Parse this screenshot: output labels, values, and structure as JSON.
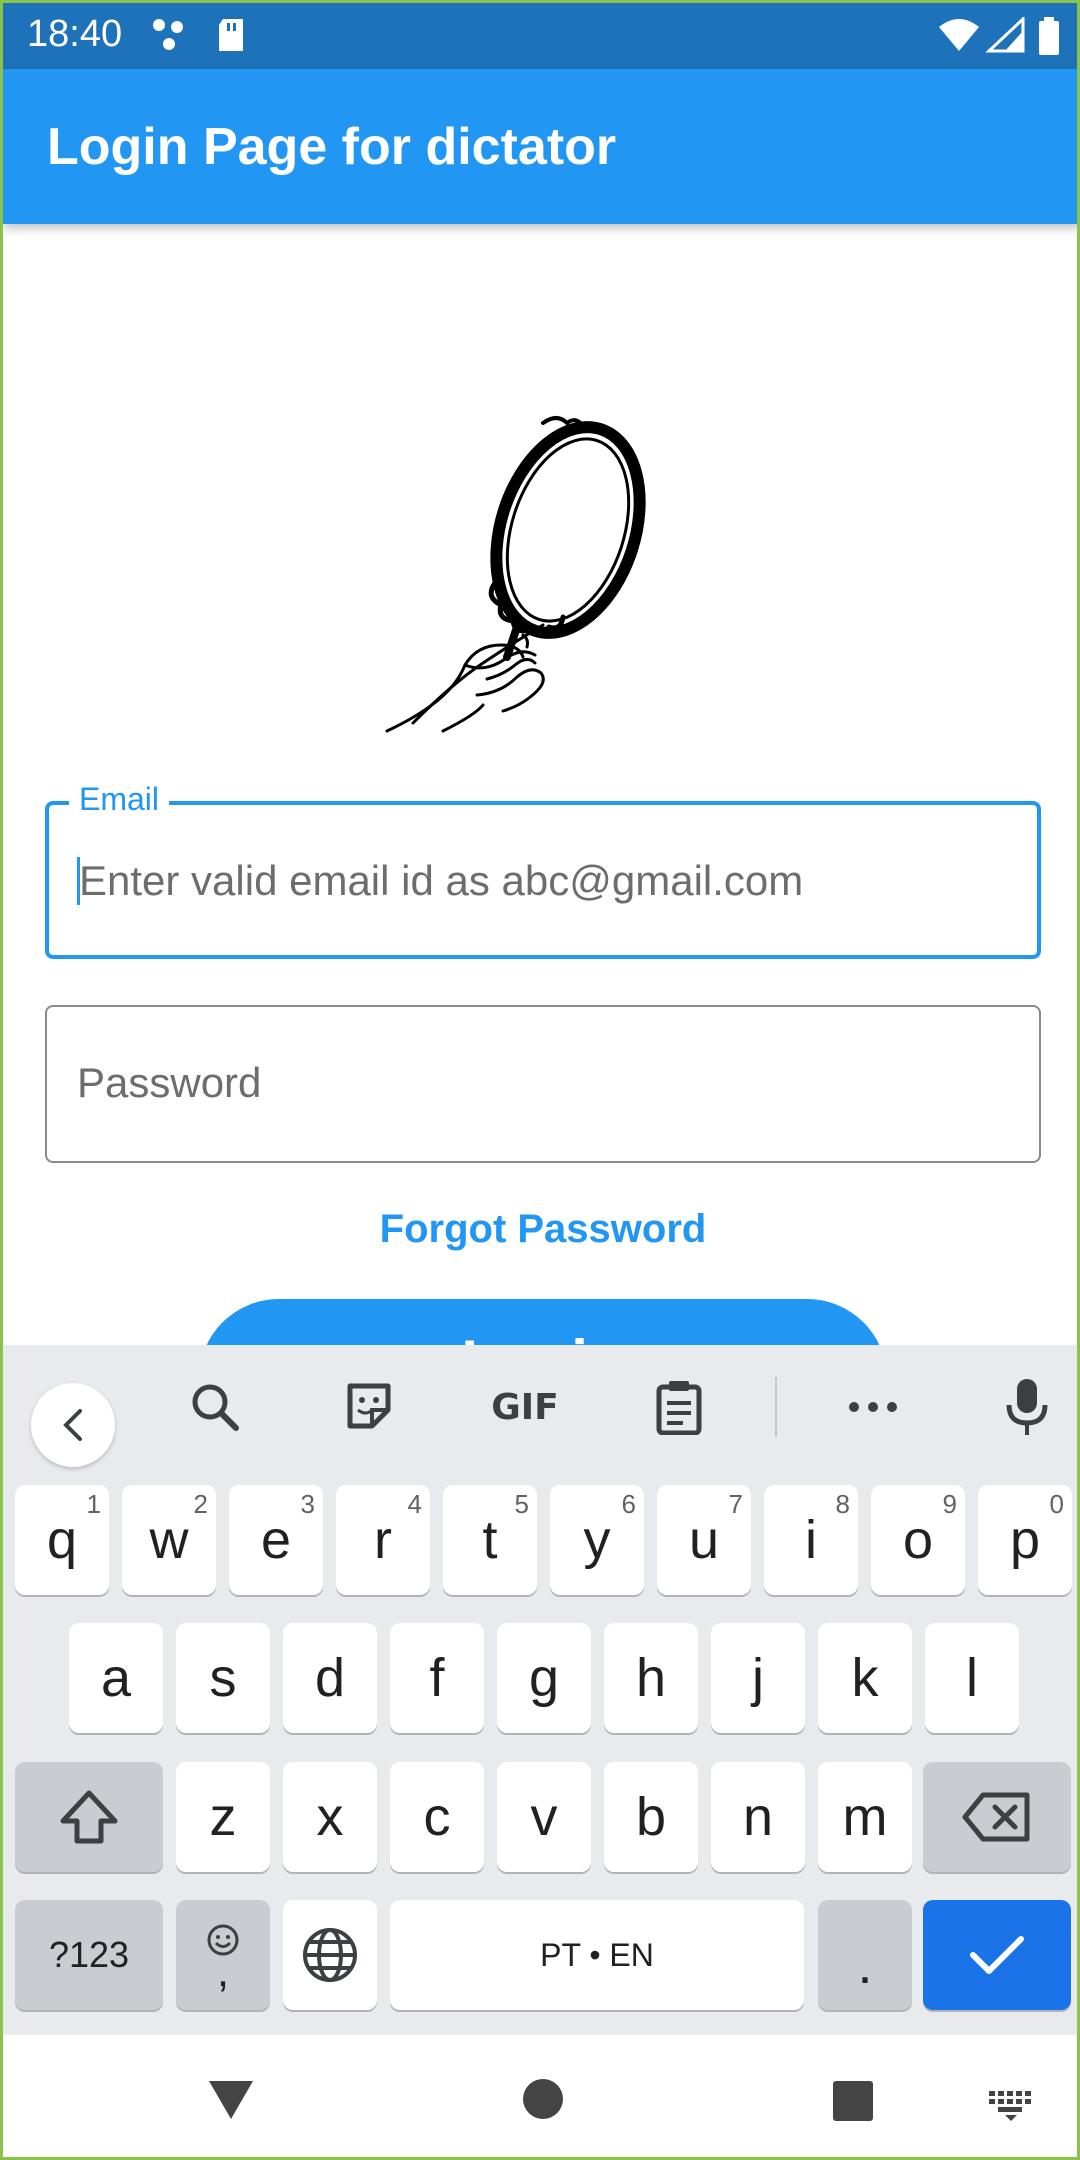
{
  "status_bar": {
    "time": "18:40",
    "icons": [
      "app-notification-icon",
      "sd-card-icon",
      "wifi-icon",
      "signal-icon",
      "battery-icon"
    ]
  },
  "app_bar": {
    "title": "Login Page for dictator"
  },
  "image": {
    "name": "hand-mirror-illustration"
  },
  "form": {
    "email": {
      "label": "Email",
      "placeholder": "Enter valid email id as abc@gmail.com"
    },
    "password": {
      "placeholder": "Password"
    },
    "forgot_password": "Forgot Password",
    "login_button": "Login"
  },
  "keyboard": {
    "toolbar": [
      "back-icon",
      "search-icon",
      "sticker-icon",
      "GIF",
      "clipboard-icon",
      "more-icon",
      "mic-icon"
    ],
    "gif_label": "GIF",
    "row1": [
      {
        "k": "q",
        "h": "1"
      },
      {
        "k": "w",
        "h": "2"
      },
      {
        "k": "e",
        "h": "3"
      },
      {
        "k": "r",
        "h": "4"
      },
      {
        "k": "t",
        "h": "5"
      },
      {
        "k": "y",
        "h": "6"
      },
      {
        "k": "u",
        "h": "7"
      },
      {
        "k": "i",
        "h": "8"
      },
      {
        "k": "o",
        "h": "9"
      },
      {
        "k": "p",
        "h": "0"
      }
    ],
    "row2": [
      "a",
      "s",
      "d",
      "f",
      "g",
      "h",
      "j",
      "k",
      "l"
    ],
    "row3": [
      "z",
      "x",
      "c",
      "v",
      "b",
      "n",
      "m"
    ],
    "symbols_label": "?123",
    "comma_label": ",",
    "space_label": "PT • EN",
    "period_label": ".",
    "colors": {
      "key_bg": "#ffffff",
      "special_key_bg": "#c9ccd1",
      "action_key_bg": "#1a73e8",
      "keyboard_bg": "#e8eaed"
    }
  },
  "colors": {
    "primary": "#2196f3",
    "status_bar": "#1e72b9",
    "field_border": "#8a8a8a"
  }
}
